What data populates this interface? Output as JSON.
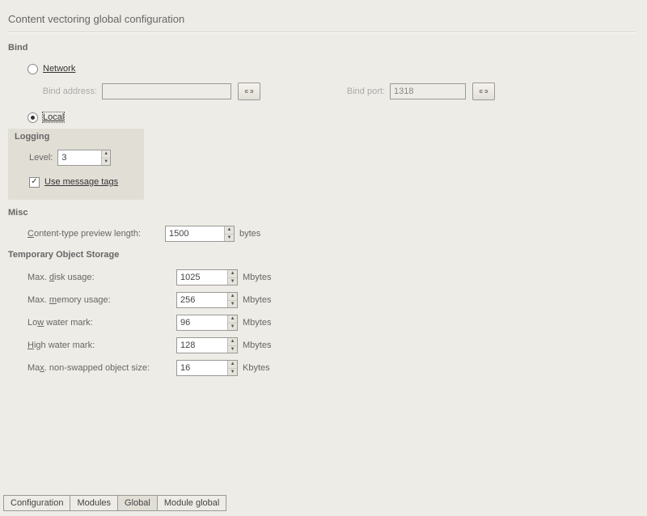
{
  "title": "Content vectoring global configuration",
  "bind": {
    "section_label": "Bind",
    "network_label": "Network",
    "local_label": "Local",
    "network_selected": false,
    "local_selected": true,
    "addr_label": "Bind address:",
    "addr_value": "",
    "port_label": "Bind port:",
    "port_value": "1318"
  },
  "logging": {
    "section_label": "Logging",
    "level_label": "Level:",
    "level_value": "3",
    "use_tags_label": "Use message tags",
    "use_tags_checked": true
  },
  "misc": {
    "section_label": "Misc",
    "preview_label": "Content-type preview length:",
    "preview_value": "1500",
    "preview_unit": "bytes"
  },
  "tos": {
    "section_label": "Temporary Object Storage",
    "unit_mb": "Mbytes",
    "unit_kb": "Kbytes",
    "rows": [
      {
        "label": "Max. disk usage:",
        "value": "1025",
        "unit": "Mbytes"
      },
      {
        "label": "Max. memory usage:",
        "value": "256",
        "unit": "Mbytes"
      },
      {
        "label": "Low water mark:",
        "value": "96",
        "unit": "Mbytes"
      },
      {
        "label": "High water mark:",
        "value": "128",
        "unit": "Mbytes"
      },
      {
        "label": "Max. non-swapped object size:",
        "value": "16",
        "unit": "Kbytes"
      }
    ]
  },
  "tabs": {
    "items": [
      "Configuration",
      "Modules",
      "Global",
      "Module global"
    ],
    "active_index": 2
  }
}
